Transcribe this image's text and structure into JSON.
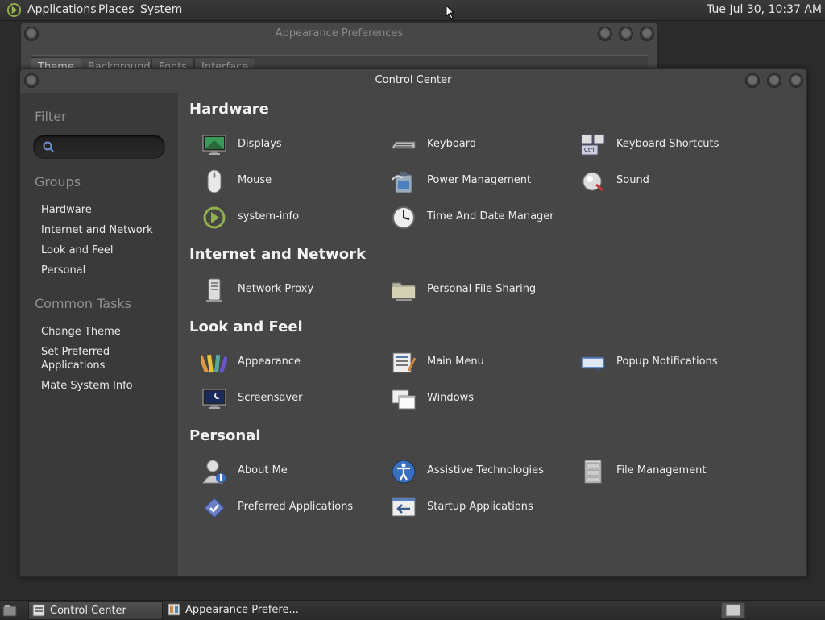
{
  "top_panel": {
    "menus": [
      "Applications",
      "Places",
      "System"
    ],
    "clock": "Tue Jul 30, 10:37 AM"
  },
  "background_window": {
    "title": "Appearance Preferences",
    "tabs": [
      "Theme",
      "Background",
      "Fonts",
      "Interface"
    ]
  },
  "control_center": {
    "title": "Control Center",
    "sidebar": {
      "filter_heading": "Filter",
      "search_value": "",
      "groups_heading": "Groups",
      "groups": [
        "Hardware",
        "Internet and Network",
        "Look and Feel",
        "Personal"
      ],
      "tasks_heading": "Common Tasks",
      "tasks": [
        "Change Theme",
        "Set Preferred Applications",
        "Mate System Info"
      ]
    },
    "sections": [
      {
        "title": "Hardware",
        "items": [
          {
            "label": "Displays",
            "icon": "display-icon"
          },
          {
            "label": "Keyboard",
            "icon": "keyboard-icon"
          },
          {
            "label": "Keyboard Shortcuts",
            "icon": "keyboard-shortcuts-icon"
          },
          {
            "label": "Mouse",
            "icon": "mouse-icon"
          },
          {
            "label": "Power Management",
            "icon": "power-icon"
          },
          {
            "label": "Sound",
            "icon": "sound-icon"
          },
          {
            "label": "system-info",
            "icon": "system-info-icon"
          },
          {
            "label": "Time And Date Manager",
            "icon": "clock-icon"
          }
        ]
      },
      {
        "title": "Internet and Network",
        "items": [
          {
            "label": "Network Proxy",
            "icon": "network-proxy-icon"
          },
          {
            "label": "Personal File Sharing",
            "icon": "folder-share-icon"
          }
        ]
      },
      {
        "title": "Look and Feel",
        "items": [
          {
            "label": "Appearance",
            "icon": "appearance-icon"
          },
          {
            "label": "Main Menu",
            "icon": "main-menu-icon"
          },
          {
            "label": "Popup Notifications",
            "icon": "notification-icon"
          },
          {
            "label": "Screensaver",
            "icon": "screensaver-icon"
          },
          {
            "label": "Windows",
            "icon": "windows-icon"
          }
        ]
      },
      {
        "title": "Personal",
        "items": [
          {
            "label": "About Me",
            "icon": "about-me-icon"
          },
          {
            "label": "Assistive Technologies",
            "icon": "accessibility-icon"
          },
          {
            "label": "File Management",
            "icon": "file-cabinet-icon"
          },
          {
            "label": "Preferred Applications",
            "icon": "preferred-apps-icon"
          },
          {
            "label": "Startup Applications",
            "icon": "startup-icon"
          }
        ]
      }
    ]
  },
  "taskbar": {
    "tasks": [
      "Control Center",
      "Appearance Prefere..."
    ]
  },
  "colors": {
    "panel": "#2e2e2e",
    "window": "#454545",
    "sidebar": "#3a3a3a",
    "text": "#e6e6e6",
    "muted_text": "#8f8f8f"
  }
}
